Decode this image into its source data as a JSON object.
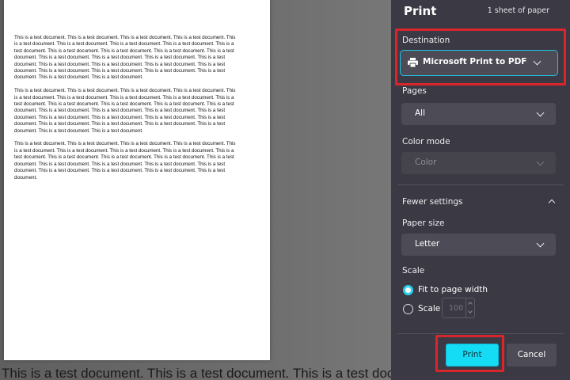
{
  "preview": {
    "paragraphs": [
      "This is a test document. This is a test document. This is a test document. This is a test document. This is a test document. This is a test document. This is a test document. This is a test document. This is a test document. This is a test document. This is a test document. This is a test document. This is a test document. This is a test document. This is a test document. This is a test document. This is a test document. This is a test document. This is a test document. This is a test document. This is a test document. This is a test document. This is a test document. This is a test document. This is a test document. This is a test document. This is a test document.",
      "This is a test document. This is a test document. This is a test document. This is a test document. This is a test document. This is a test document. This is a test document. This is a test document. This is a test document. This is a test document. This is a test document. This is a test document. This is a test document. This is a test document. This is a test document. This is a test document. This is a test document. This is a test document. This is a test document. This is a test document. This is a test document. This is a test document. This is a test document. This is a test document. This is a test document. This is a test document. This is a test document.",
      "This is a test document. This is a test document. This is a test document. This is a test document. This is a test document. This is a test document. This is a test document. This is a test document. This is a test document. This is a test document. This is a test document. This is a test document. This is a test document. This is a test document. This is a test document. This is a test document. This is a test document. This is a test document. This is a test document. This is a test document. This is a test document."
    ],
    "background_text": "This is a test document. This is a test document. This is a test document. This is a"
  },
  "panel": {
    "title": "Print",
    "sheet_count": "1 sheet of paper",
    "destination_label": "Destination",
    "destination_value": "Microsoft Print to PDF",
    "pages_label": "Pages",
    "pages_value": "All",
    "color_mode_label": "Color mode",
    "color_mode_value": "Color",
    "fewer_settings_label": "Fewer settings",
    "paper_size_label": "Paper size",
    "paper_size_value": "Letter",
    "scale_label": "Scale",
    "fit_option_label": "Fit to page width",
    "scale_option_label": "Scale",
    "scale_value": "100",
    "print_button": "Print",
    "cancel_button": "Cancel"
  },
  "colors": {
    "panel_bg": "#3b3a44",
    "accent": "#14dcf5",
    "highlight": "#d9262c"
  },
  "icons": [
    "printer-icon",
    "chevron-down-icon",
    "chevron-up-icon"
  ],
  "state": {
    "selected_scale_option": "fit",
    "color_mode_disabled": true
  }
}
